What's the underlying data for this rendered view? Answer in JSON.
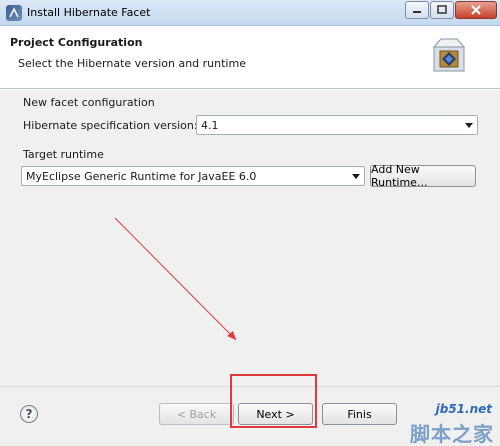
{
  "window": {
    "title": "Install Hibernate Facet",
    "icons": {
      "app": "eclipse-icon",
      "minimize": "minimize-icon",
      "maximize": "maximize-icon",
      "close": "close-icon"
    }
  },
  "header": {
    "title": "Project Configuration",
    "subtitle": "Select the Hibernate version and runtime",
    "image_icon": "facet-box-icon"
  },
  "facet_config": {
    "group_label": "New facet configuration",
    "spec_label": "Hibernate specification version:",
    "spec_value": "4.1"
  },
  "target_runtime": {
    "group_label": "Target runtime",
    "runtime_value": "MyEclipse Generic Runtime for JavaEE 6.0",
    "add_button": "Add New Runtime..."
  },
  "footer": {
    "help_glyph": "?",
    "back_label": "< Back",
    "next_label": "Next >",
    "finish_label": "Finis"
  },
  "annotation": {
    "color": "#e23a3a"
  },
  "watermark": {
    "site": "jb51.net",
    "name": "脚本之家"
  }
}
